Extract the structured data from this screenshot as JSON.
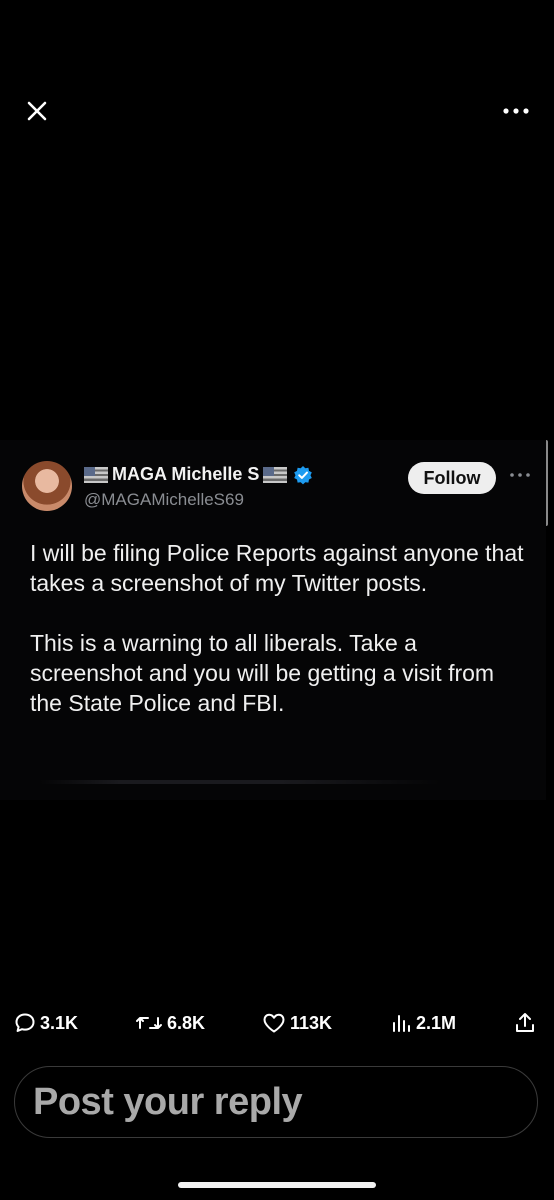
{
  "tweet": {
    "display_name": "MAGA Michelle S",
    "handle": "@MAGAMichelleS69",
    "follow_label": "Follow",
    "paragraph_1": "I will be filing Police Reports against anyone that takes a screenshot of my Twitter posts.",
    "paragraph_2": "This is a warning to all liberals. Take a screenshot and you will be getting a visit from the State Police and FBI."
  },
  "stats": {
    "replies": "3.1K",
    "reposts": "6.8K",
    "likes": "113K",
    "views": "2.1M"
  },
  "reply": {
    "placeholder": "Post your reply"
  },
  "icons": {
    "close": "close-icon",
    "more": "more-icon",
    "reply": "reply-icon",
    "repost": "repost-icon",
    "like": "heart-icon",
    "views": "views-icon",
    "share": "share-icon",
    "verified": "verified-badge-icon"
  },
  "colors": {
    "background": "#000000",
    "verified_blue": "#1d9bf0",
    "follow_bg": "#eeeeee"
  }
}
